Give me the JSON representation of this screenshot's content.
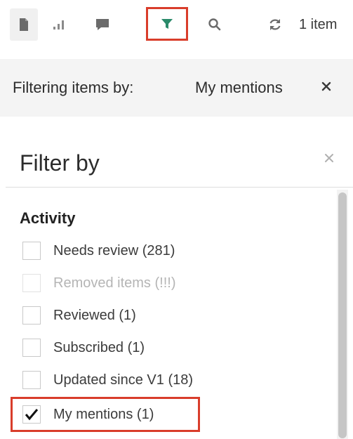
{
  "toolbar": {
    "items_count": "1 item",
    "icons": {
      "documents": "document-icon",
      "stats": "bar-chart-icon",
      "comments": "comment-icon",
      "filter": "filter-icon",
      "search": "search-icon",
      "refresh": "refresh-icon"
    },
    "accent_color": "#2a8a6a",
    "highlight_color": "#d93d2b"
  },
  "filter_summary": {
    "label": "Filtering items by:",
    "active_filter": "My mentions",
    "remove_icon": "close-icon"
  },
  "filter_panel": {
    "title": "Filter by",
    "close_icon": "close-icon",
    "section": "Activity",
    "options": [
      {
        "label": "Needs review (281)",
        "checked": false,
        "disabled": false
      },
      {
        "label": "Removed items (!!!)",
        "checked": false,
        "disabled": true
      },
      {
        "label": "Reviewed (1)",
        "checked": false,
        "disabled": false
      },
      {
        "label": "Subscribed (1)",
        "checked": false,
        "disabled": false
      },
      {
        "label": "Updated since V1 (18)",
        "checked": false,
        "disabled": false
      },
      {
        "label": "My mentions (1)",
        "checked": true,
        "disabled": false
      }
    ]
  }
}
